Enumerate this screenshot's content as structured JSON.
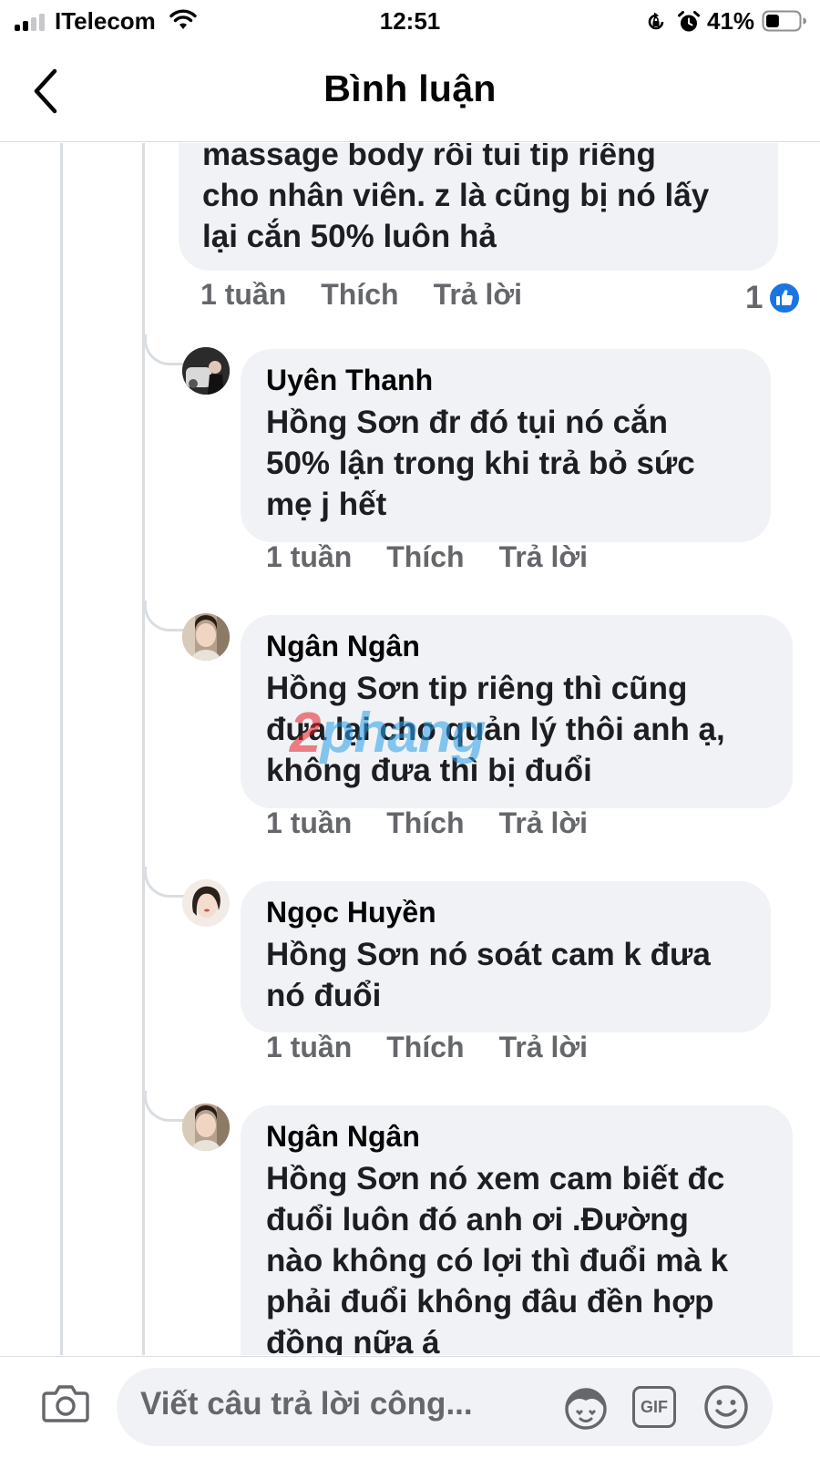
{
  "status_bar": {
    "carrier": "ITelecom",
    "time": "12:51",
    "battery_percent": "41%",
    "battery_level": 0.41
  },
  "header": {
    "title": "Bình luận"
  },
  "colors": {
    "bubble": "#f0f2f5",
    "like_blue": "#1b74e4",
    "secondary_text": "#65676b",
    "primary_text": "#050505"
  },
  "first_comment": {
    "text": "massage body rôi tui tip riêng\ncho nhân viên. z là cũng bị nó lấy\nlại cắn 50% luôn hả",
    "time": "1 tuần",
    "like_label": "Thích",
    "reply_label": "Trả lời",
    "reaction_count": "1",
    "reaction_icon": "thumbs-up-icon"
  },
  "replies": [
    {
      "author": "Uyên Thanh",
      "text": "Hồng Sơn đr đó tụi nó cắn\n50% lận trong khi trả bỏ sức\nmẹ j hết",
      "time": "1 tuần",
      "like_label": "Thích",
      "reply_label": "Trả lời"
    },
    {
      "author": "Ngân Ngân",
      "text": "Hồng Sơn tip riêng thì cũng\nđưa lại cho quản lý thôi anh ạ,\nkhông đưa thì bị đuổi",
      "time": "1 tuần",
      "like_label": "Thích",
      "reply_label": "Trả lời"
    },
    {
      "author": "Ngọc Huyền",
      "text": "Hồng Sơn nó soát cam k đưa\nnó đuổi",
      "time": "1 tuần",
      "like_label": "Thích",
      "reply_label": "Trả lời"
    },
    {
      "author": "Ngân Ngân",
      "text": "Hồng Sơn nó xem cam biết đc\nđuổi luôn đó anh ơi .Đường\nnào không có lợi thì đuổi mà k\nphải đuổi không đâu đền hợp\nđồng nữa á"
    }
  ],
  "watermark": {
    "part_a": "2",
    "part_b": "phang"
  },
  "composer": {
    "placeholder": "Viết câu trả lời công...",
    "gif_label": "GIF",
    "icons": [
      "camera-icon",
      "avatar-sticker-icon",
      "gif-icon",
      "emoji-icon"
    ]
  }
}
